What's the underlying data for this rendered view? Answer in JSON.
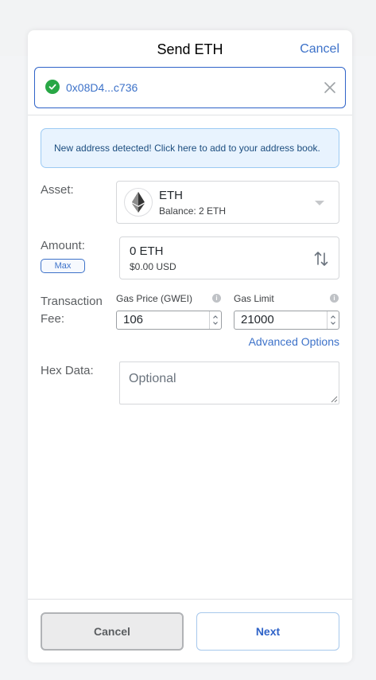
{
  "header": {
    "title": "Send ETH",
    "cancel_label": "Cancel"
  },
  "recipient": {
    "address": "0x08D4...c736",
    "status_icon": "check-circle-icon",
    "clear_icon": "close-icon"
  },
  "notice": {
    "text": "New address detected! Click here to add to your address book."
  },
  "asset": {
    "label": "Asset:",
    "name": "ETH",
    "balance": "Balance: 2 ETH",
    "icon": "ethereum-icon"
  },
  "amount": {
    "label": "Amount:",
    "max_label": "Max",
    "value": "0 ETH",
    "fiat": "$0.00 USD",
    "swap_icon": "swap-icon"
  },
  "fee": {
    "label_line1": "Transaction",
    "label_line2": "Fee:",
    "gas_price_label": "Gas Price (GWEI)",
    "gas_price_value": "106",
    "gas_limit_label": "Gas Limit",
    "gas_limit_value": "21000",
    "advanced_label": "Advanced Options"
  },
  "hex": {
    "label": "Hex Data:",
    "placeholder": "Optional"
  },
  "footer": {
    "cancel_label": "Cancel",
    "next_label": "Next"
  },
  "colors": {
    "accent": "#3d72c9",
    "success": "#28a745",
    "notice_bg": "#e8f3fe"
  }
}
